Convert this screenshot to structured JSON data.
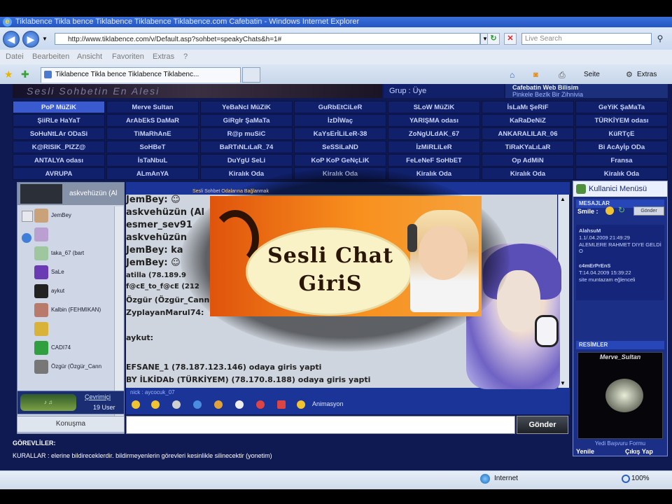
{
  "browser": {
    "title": "Tiklabence Tikla bence Tiklabence Tiklabence Tiklabence.com Cafebatin - Windows Internet Explorer",
    "url": "http://www.tiklabence.com/v/Default.asp?sohbet=speakyChats&h=1#",
    "search_placeholder": "Live Search",
    "menu": [
      "Datei",
      "Bearbeiten",
      "Ansicht",
      "Favoriten",
      "Extras",
      "?"
    ],
    "tab_title": "Tiklabence Tikla bence Tiklabence Tiklabenc...",
    "toolbar": {
      "page": "Seite",
      "tools": "Extras"
    },
    "status_zone": "Internet",
    "zoom": "100%"
  },
  "header": {
    "banner_text": "Sesli Sohbetin En Alesi",
    "group_label": "Grup : Üye",
    "site_title": "Cafebatin Web Bilisim",
    "site_subtitle": "Pinkele Bezlk Bir Zihnivia"
  },
  "rooms": [
    "PoP MüZiK",
    "Merve Sultan",
    "YeBaNcI MüZiK",
    "GuRbEtCiLeR",
    "SLoW MüZiK",
    "İsLaMı ŞeRiF",
    "GeYiK ŞaMaTa",
    "ŞiiRLe HaYaT",
    "ArAbEkS DaMaR",
    "GiRgIr ŞaMaTa",
    "İzDİWaç",
    "YARIŞMA odası",
    "KaRaDeNiZ",
    "TÜRKİYEM odası",
    "SoHuNtLAr ODaSi",
    "TiMaRhAnE",
    "R@p muSiC",
    "KaYsErİLiLeR-38",
    "ZoNgULdAK_67",
    "ANKARALILAR_06",
    "KüRTçE",
    "K@RISIK_PIZZ@",
    "SoHBeT",
    "BaRTıNLıLaR_74",
    "SeSSiLaND",
    "İzMiRLiLeR",
    "TiRaKYaLıLaR",
    "Bi AcAyİp ODa",
    "ANTALYA odası",
    "İsTaNbuL",
    "DuYgU SeLi",
    "KoP KoP GeNçLiK",
    "FeLeNeF SoHbET",
    "Op AdMiN",
    "Fransa",
    "AVRUPA",
    "ALmAnYA",
    "Kiralık Oda",
    "Kiralık Oda",
    "Kiralık Oda",
    "Kiralık Oda",
    "Kiralık Oda"
  ],
  "users": {
    "header_name": "askvehüzün (Al",
    "list": [
      {
        "name": "JemBey",
        "color": "#c9a27a"
      },
      {
        "name": "",
        "color": "#b9a0d0"
      },
      {
        "name": "taka_67 (bart",
        "color": "#9ec7a0"
      },
      {
        "name": "SaLe",
        "color": "#6a3bb3"
      },
      {
        "name": "aykut",
        "color": "#222222"
      },
      {
        "name": "Kalbin (FEHMIKAN)",
        "color": "#b87a6a"
      },
      {
        "name": "",
        "color": "#d9b23a"
      },
      {
        "name": "CADI74",
        "color": "#2f9f3f"
      },
      {
        "name": "Özgür (Özgür_Cann",
        "color": "#777777"
      }
    ],
    "online_label": "Çevrimiçi",
    "count": "19 User",
    "talk_button": "Konuşma"
  },
  "chat": {
    "lines": [
      {
        "text": "JemBey: ☺",
        "size": 13
      },
      {
        "text": "askvehüzün (Al",
        "size": 13
      },
      {
        "text": "esmer_sev91",
        "size": 13
      },
      {
        "text": "askvehüzün",
        "size": 13
      },
      {
        "text": "JemBey: ka",
        "size": 13
      },
      {
        "text": "JemBey: ☺",
        "size": 13
      },
      {
        "text": "atilla (78.189.9",
        "size": 10
      },
      {
        "text": "f@cE_to_f@cE (212",
        "size": 10
      },
      {
        "text": "Özgür (Özgür_Cann",
        "size": 11
      },
      {
        "text": "ZyplayanMarul74:",
        "size": 11
      },
      {
        "text": "aykut:",
        "size": 11
      },
      {
        "text": "EFSANE_1 (78.187.123.146) odaya giris yapti",
        "size": 11
      },
      {
        "text": "BY İLKİDAb (TÜRKİYEM) (78.170.8.188) odaya giris yapti",
        "size": 11
      }
    ],
    "nick_line": "nick : aycocuk_07",
    "animation_label": "Animasyon",
    "send_button": "Gönder"
  },
  "ad": {
    "title": "Sesli Sohbet Odalarına Bağlanmak",
    "line1": "Sesli Chat",
    "line2": "GiriS"
  },
  "right_panel": {
    "title": "Kullanici Menüsü",
    "messages_header": "MESAJLAR",
    "smile_label": "Smile :",
    "smile_button": "Gönder",
    "messages": [
      {
        "author": "AlahsuM",
        "date": "1.1/.04.2009 21:49:29",
        "text": "ALEMLERE RAHMET DIYE GELDİ O"
      },
      {
        "author": "c4mErPrEnS",
        "date": "T:14.04.2009 15:39:22",
        "text": "site muntazam eğlenceli"
      }
    ],
    "pictures_header": "RESİMLER",
    "picture_name": "Merve_Sultan",
    "form_link": "Yedi Başvuru Formu",
    "refresh": "Yenile",
    "exit": "Çıkış Yap"
  },
  "footer": {
    "staff_label": "GÖREVLİLER:",
    "rules": "KURALLAR : elerine bildireceklerdir. bildirmeyenlerin görevleri kesinlikle silinecektir (yonetim)"
  }
}
